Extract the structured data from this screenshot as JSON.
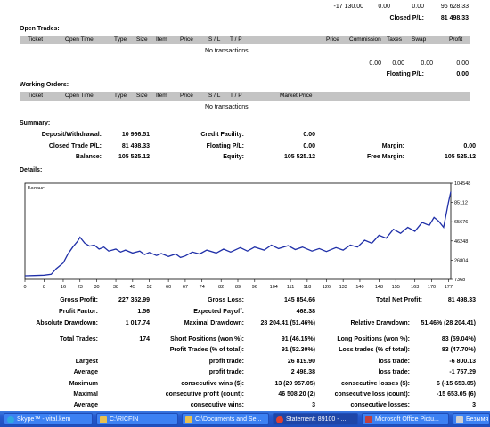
{
  "top": {
    "v1": "-17 130.00",
    "v2": "0.00",
    "v3": "0.00",
    "v4": "96 628.33",
    "closed_pl_label": "Closed P/L:",
    "closed_pl": "81 498.33"
  },
  "open_trades": {
    "title": "Open Trades:",
    "columns": [
      "Ticket",
      "Open Time",
      "Type",
      "Size",
      "Item",
      "Price",
      "S / L",
      "T / P",
      "Price",
      "Commission",
      "Taxes",
      "Swap",
      "Profit"
    ],
    "empty": "No transactions",
    "totals": [
      "0.00",
      "0.00",
      "0.00",
      "0.00"
    ],
    "floating_label": "Floating P/L:",
    "floating": "0.00"
  },
  "working_orders": {
    "title": "Working Orders:",
    "columns": [
      "Ticket",
      "Open Time",
      "Type",
      "Size",
      "Item",
      "Price",
      "S / L",
      "T / P",
      "Market Price"
    ],
    "empty": "No transactions"
  },
  "summary": {
    "title": "Summary:",
    "deposit_label": "Deposit/Withdrawal:",
    "deposit": "10 966.51",
    "credit_label": "Credit Facility:",
    "credit": "0.00",
    "closed_label": "Closed Trade P/L:",
    "closed": "81 498.33",
    "floating_label": "Floating P/L:",
    "floating": "0.00",
    "margin_label": "Margin:",
    "margin": "0.00",
    "balance_label": "Balance:",
    "balance": "105 525.12",
    "equity_label": "Equity:",
    "equity": "105 525.12",
    "free_margin_label": "Free Margin:",
    "free_margin": "105 525.12"
  },
  "details": {
    "title": "Details:"
  },
  "chart_data": {
    "type": "line",
    "legend": "Баланс",
    "x_ticks": [
      0,
      8,
      16,
      23,
      30,
      38,
      45,
      52,
      60,
      67,
      74,
      82,
      89,
      96,
      104,
      111,
      118,
      126,
      133,
      140,
      148,
      155,
      163,
      170,
      177
    ],
    "y_ticks": [
      "104548",
      "85112",
      "65676",
      "46248",
      "26804",
      "7368"
    ],
    "ylim": [
      7368,
      104548
    ],
    "x": [
      0,
      4,
      8,
      11,
      13,
      16,
      18,
      20,
      22,
      23,
      25,
      27,
      29,
      31,
      33,
      35,
      38,
      40,
      42,
      45,
      48,
      50,
      52,
      55,
      57,
      60,
      63,
      65,
      67,
      70,
      73,
      76,
      80,
      83,
      86,
      90,
      93,
      96,
      100,
      103,
      106,
      110,
      113,
      116,
      120,
      123,
      126,
      130,
      133,
      136,
      139,
      142,
      145,
      148,
      151,
      154,
      157,
      160,
      163,
      166,
      169,
      171,
      173,
      175,
      177,
      178
    ],
    "y": [
      10966,
      11200,
      11600,
      12500,
      18000,
      24000,
      33000,
      40000,
      46000,
      50000,
      44000,
      41000,
      42000,
      38000,
      40000,
      36000,
      38000,
      35000,
      37000,
      34000,
      36000,
      32500,
      34500,
      31500,
      33500,
      30500,
      33000,
      29500,
      31000,
      35000,
      33000,
      37000,
      34000,
      38000,
      35000,
      39500,
      36000,
      40000,
      37000,
      42000,
      38500,
      41500,
      37500,
      40000,
      36000,
      38500,
      35500,
      39500,
      37000,
      42000,
      40000,
      47000,
      44000,
      52000,
      49000,
      58000,
      54000,
      60000,
      56000,
      65000,
      62000,
      70000,
      66000,
      60000,
      85000,
      96000
    ]
  },
  "stats": {
    "gross_profit_label": "Gross Profit:",
    "gross_profit": "227 352.99",
    "gross_loss_label": "Gross Loss:",
    "gross_loss": "145 854.66",
    "total_net_label": "Total Net Profit:",
    "total_net": "81 498.33",
    "profit_factor_label": "Profit Factor:",
    "profit_factor": "1.56",
    "expected_payoff_label": "Expected Payoff:",
    "expected_payoff": "468.38",
    "abs_dd_label": "Absolute Drawdown:",
    "abs_dd": "1 017.74",
    "max_dd_label": "Maximal Drawdown:",
    "max_dd": "28 204.41 (51.46%)",
    "rel_dd_label": "Relative Drawdown:",
    "rel_dd": "51.46% (28 204.41)",
    "total_trades_label": "Total Trades:",
    "total_trades": "174",
    "short_label": "Short Positions (won %):",
    "short": "91 (46.15%)",
    "long_label": "Long Positions (won %):",
    "long": "83 (59.04%)",
    "profit_trades_label": "Profit Trades (% of total):",
    "profit_trades": "91 (52.30%)",
    "loss_trades_label": "Loss trades (% of total):",
    "loss_trades": "83 (47.70%)",
    "largest_label": "Largest",
    "largest_profit_label": "profit trade:",
    "largest_profit": "26 819.90",
    "largest_loss_label": "loss trade:",
    "largest_loss": "-6 800.13",
    "average_label": "Average",
    "average_profit_label": "profit trade:",
    "average_profit": "2 498.38",
    "average_loss_label": "loss trade:",
    "average_loss": "-1 757.29",
    "maximum_label": "Maximum",
    "max_cons_wins_label": "consecutive wins ($):",
    "max_cons_wins": "13 (20 957.05)",
    "max_cons_losses_label": "consecutive losses ($):",
    "max_cons_losses": "6 (-15 653.05)",
    "maximal_label": "Maximal",
    "maximal_profit_label": "consecutive profit (count):",
    "maximal_profit": "46 508.20 (2)",
    "maximal_loss_label": "consecutive loss (count):",
    "maximal_loss": "-15 653.05 (6)",
    "avg2_label": "Average",
    "avg_wins_label": "consecutive wins:",
    "avg_wins": "3",
    "avg_losses_label": "consecutive losses:",
    "avg_losses": "3"
  },
  "taskbar": {
    "items": [
      "Skype™ - vital.kem",
      "C:\\RICFIN",
      "C:\\Documents and Se...",
      "Statement: 89100 - ...",
      "Microsoft Office Pictu...",
      "Безымя"
    ],
    "colors": [
      "#2ea8e0",
      "#e8c050",
      "#e8c050",
      "#e04030",
      "#c04040",
      "#d0d0d0"
    ]
  }
}
